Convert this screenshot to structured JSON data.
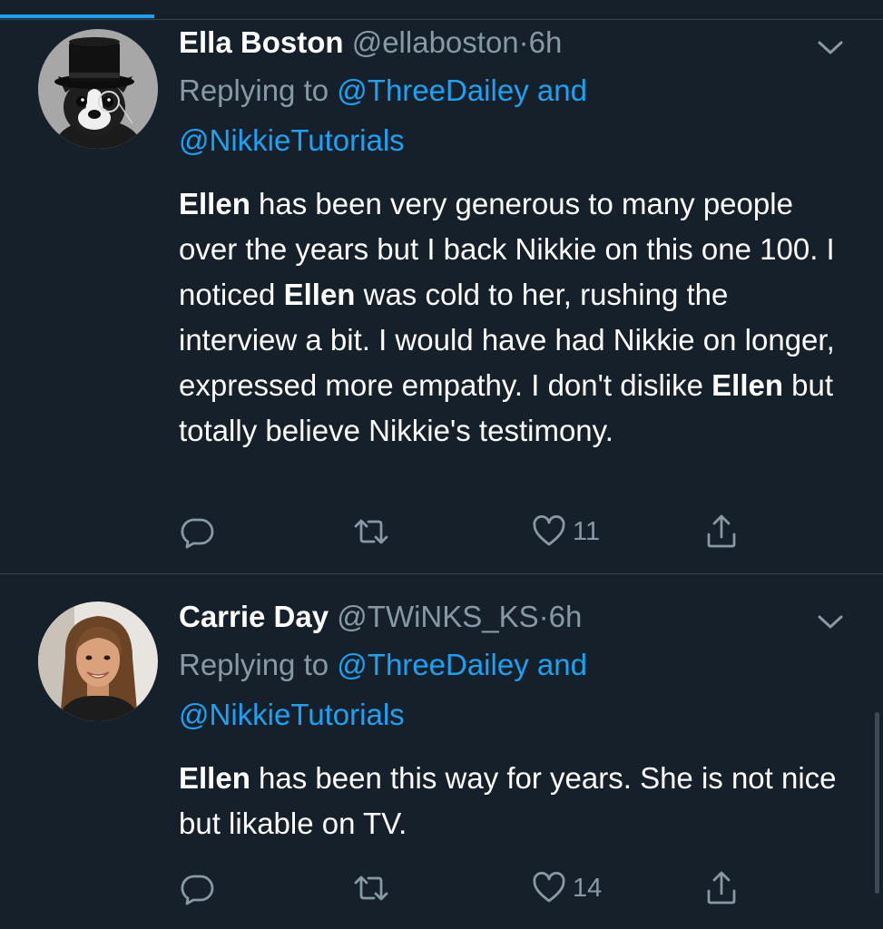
{
  "tweets": [
    {
      "display_name": "Ella Boston",
      "handle": "@ellaboston",
      "separator": "·",
      "time": "6h",
      "replying_prefix": "Replying to",
      "replying_mention_1": "@ThreeDailey",
      "replying_and": "and",
      "replying_mention_2": "@NikkieTutorials",
      "text": {
        "p1": "Ellen",
        "p2": " has been very generous to many people over the years but I back Nikkie on this one 100. I noticed ",
        "p3": "Ellen",
        "p4": " was cold to her, rushing the interview a bit. I would have had Nikkie on longer, expressed more empathy. I don't dislike ",
        "p5": "Ellen",
        "p6": " but totally believe Nikkie's testimony."
      },
      "like_count": "11",
      "avatar_icon": "boston-terrier-top-hat-avatar"
    },
    {
      "display_name": "Carrie Day",
      "handle": "@TWiNKS_KS",
      "separator": "·",
      "time": "6h",
      "replying_prefix": "Replying to",
      "replying_mention_1": "@ThreeDailey",
      "replying_and": "and",
      "replying_mention_2": "@NikkieTutorials",
      "text": {
        "p1": "Ellen",
        "p2": " has been this way for years. She is not nice but likable on TV."
      },
      "like_count": "14",
      "avatar_icon": "woman-portrait-avatar"
    }
  ],
  "colors": {
    "background": "#15202b",
    "accent": "#1da1f2",
    "muted": "#8899a6",
    "divider": "#38444d"
  }
}
